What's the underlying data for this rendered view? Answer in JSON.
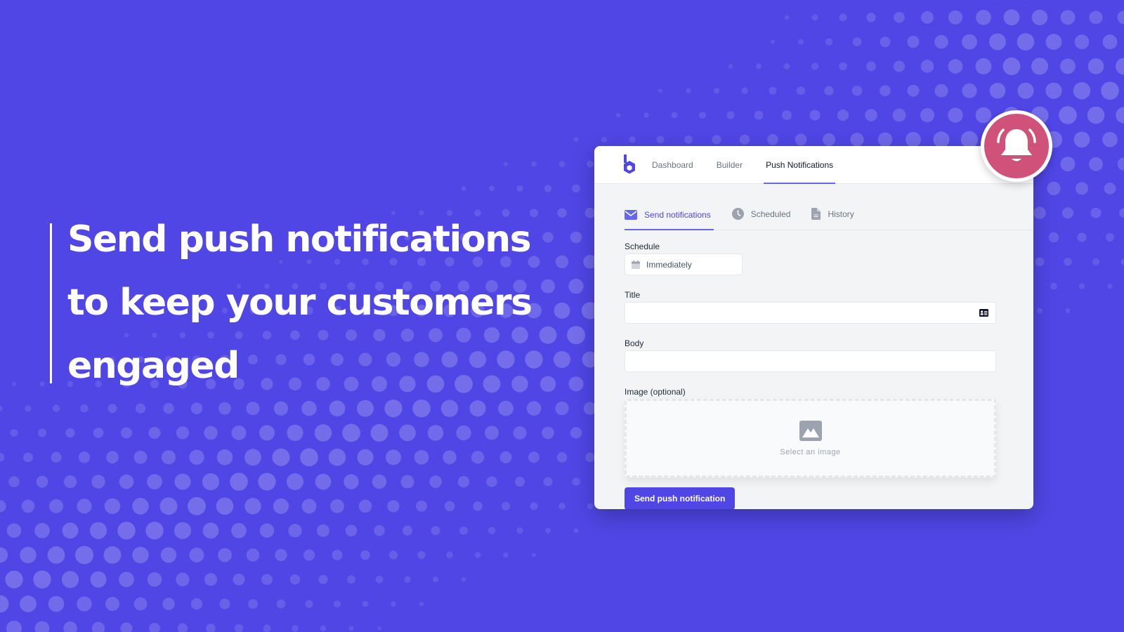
{
  "hero": {
    "headline_lines": [
      "Send push notifications",
      "to keep your customers",
      "engaged"
    ]
  },
  "app": {
    "nav": [
      {
        "label": "Dashboard",
        "active": false
      },
      {
        "label": "Builder",
        "active": false
      },
      {
        "label": "Push Notifications",
        "active": true
      }
    ],
    "subtabs": [
      {
        "label": "Send notifications",
        "icon": "envelope-icon",
        "active": true
      },
      {
        "label": "Scheduled",
        "icon": "clock-icon",
        "active": false
      },
      {
        "label": "History",
        "icon": "document-icon",
        "active": false
      }
    ],
    "form": {
      "schedule_label": "Schedule",
      "schedule_value": "Immediately",
      "title_label": "Title",
      "title_value": "",
      "body_label": "Body",
      "body_value": "",
      "image_label": "Image (optional)",
      "image_hint": "Select an image",
      "submit_label": "Send push notification"
    }
  },
  "colors": {
    "background": "#4f46e5",
    "accent": "#6366f1",
    "bell_badge": "#d0527a"
  }
}
